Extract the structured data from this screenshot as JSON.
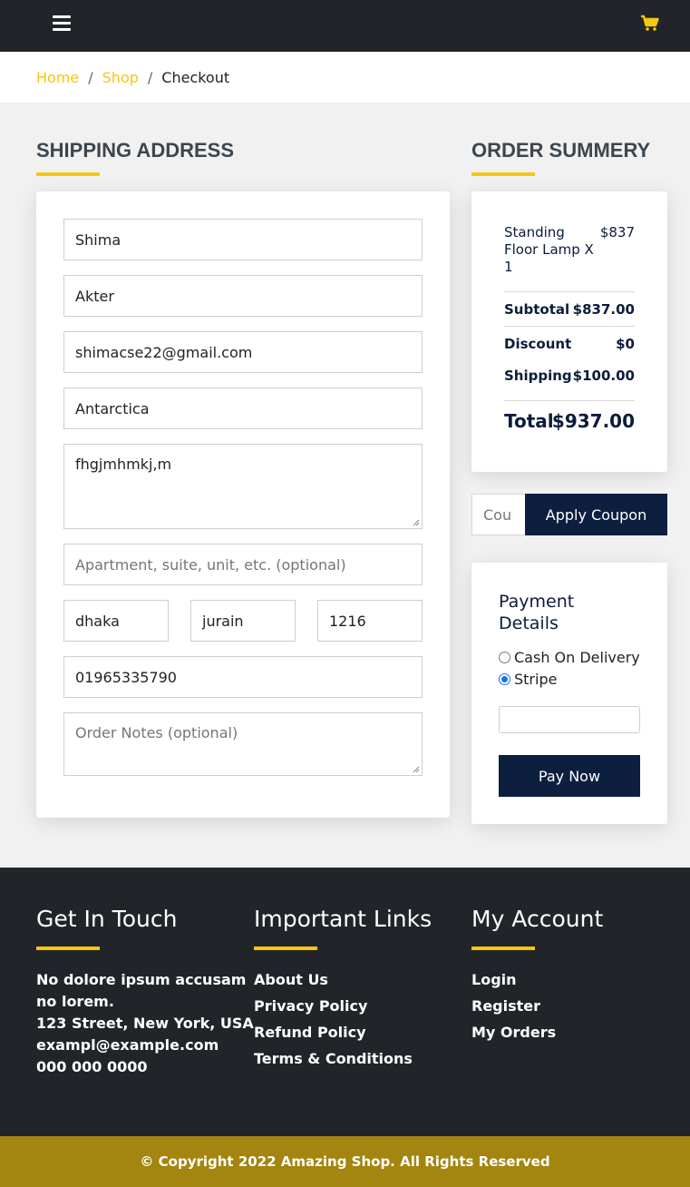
{
  "nav": {
    "menu_icon": "hamburger-icon",
    "cart_icon": "cart-icon",
    "accent": "#f7c60e"
  },
  "breadcrumb": {
    "home": "Home",
    "shop": "Shop",
    "current": "Checkout",
    "separator": "/"
  },
  "shipping": {
    "title": "SHIPPING ADDRESS",
    "first_name": "Shima",
    "last_name": "Akter",
    "email": "shimacse22@gmail.com",
    "country": "Antarctica",
    "address": "fhgjmhmkj,m",
    "apartment_placeholder": "Apartment, suite, unit, etc. (optional)",
    "city": "dhaka",
    "state": "jurain",
    "zip": "1216",
    "phone": "01965335790",
    "notes_placeholder": "Order Notes (optional)"
  },
  "summary": {
    "title": "ORDER SUMMERY",
    "item_line1": "Standing",
    "item_line2": "Floor Lamp X",
    "item_line3": "1",
    "item_price": "$837",
    "subtotal_label": "Subtotal",
    "subtotal_value": "$837.00",
    "discount_label": "Discount",
    "discount_value": "$0",
    "shipping_label": "Shipping",
    "shipping_value": "$100.00",
    "total_label": "Total",
    "total_value": "$937.00"
  },
  "coupon": {
    "placeholder": "Cou",
    "button": "Apply Coupon"
  },
  "payment": {
    "title_line1": "Payment",
    "title_line2": "Details",
    "options": [
      {
        "label": "Cash On Delivery",
        "checked": false
      },
      {
        "label": "Stripe",
        "checked": true
      }
    ],
    "pay_button": "Pay Now"
  },
  "footer": {
    "contact": {
      "title": "Get In Touch",
      "line1": "No dolore ipsum accusam",
      "line2": "no lorem.",
      "address": "123 Street, New York, USA",
      "email": "exampl@example.com",
      "phone": "000 000 0000"
    },
    "links": {
      "title": "Important Links",
      "items": [
        "About Us",
        "Privacy Policy",
        "Refund Policy",
        "Terms & Conditions"
      ]
    },
    "account": {
      "title": "My Account",
      "items": [
        "Login",
        "Register",
        "My Orders"
      ]
    },
    "copyright": "© Copyright 2022 Amazing Shop. All Rights Reserved"
  }
}
